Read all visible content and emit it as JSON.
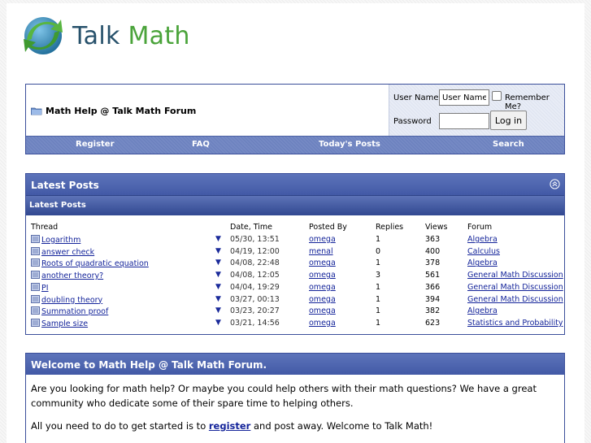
{
  "brand": {
    "logo_text_1": "Talk ",
    "logo_text_2": "Math"
  },
  "navbar": {
    "title": "Math Help @ Talk Math Forum",
    "login": {
      "username_label": "User Name",
      "username_value": "User Name",
      "remember_label": "Remember Me?",
      "password_label": "Password",
      "login_button": "Log in"
    },
    "links": [
      "Register",
      "FAQ",
      "Today's Posts",
      "Search"
    ]
  },
  "latest": {
    "title": "Latest Posts",
    "subtitle": "Latest Posts",
    "columns": [
      "Thread",
      "Date, Time",
      "Posted By",
      "Replies",
      "Views",
      "Forum"
    ],
    "rows": [
      {
        "thread": "Logarithm",
        "date": "05/30, 13:51",
        "by": "omega",
        "replies": "1",
        "views": "363",
        "forum": "Algebra"
      },
      {
        "thread": "answer check",
        "date": "04/19, 12:00",
        "by": "menal",
        "replies": "0",
        "views": "400",
        "forum": "Calculus"
      },
      {
        "thread": "Roots of quadratic equation",
        "date": "04/08, 22:48",
        "by": "omega",
        "replies": "1",
        "views": "378",
        "forum": "Algebra"
      },
      {
        "thread": "another theory?",
        "date": "04/08, 12:05",
        "by": "omega",
        "replies": "3",
        "views": "561",
        "forum": "General Math Discussion"
      },
      {
        "thread": "PI",
        "date": "04/04, 19:29",
        "by": "omega",
        "replies": "1",
        "views": "366",
        "forum": "General Math Discussion"
      },
      {
        "thread": "doubling theory",
        "date": "03/27, 00:13",
        "by": "omega",
        "replies": "1",
        "views": "394",
        "forum": "General Math Discussion"
      },
      {
        "thread": "Summation proof",
        "date": "03/23, 20:27",
        "by": "omega",
        "replies": "1",
        "views": "382",
        "forum": "Algebra"
      },
      {
        "thread": "Sample size",
        "date": "03/21, 14:56",
        "by": "omega",
        "replies": "1",
        "views": "623",
        "forum": "Statistics and Probability"
      }
    ]
  },
  "welcome": {
    "title": "Welcome to Math Help @ Talk Math Forum.",
    "para1": "Are you looking for math help? Or maybe you could help others with their math questions? We have a great community who dedicate some of their spare time to helping others.",
    "para2_before": "All you need to do to get started is to ",
    "para2_link": "register",
    "para2_after": " and post away. Welcome to Talk Math!"
  },
  "colors": {
    "accent": "#4e66b0",
    "link": "#14249a",
    "logo_green": "#4aa33a",
    "logo_navy": "#27516b"
  },
  "icons": [
    "talkmath-logo-icon",
    "folder-icon",
    "collapse-icon",
    "thread-doc-icon",
    "triangle-down-icon"
  ]
}
